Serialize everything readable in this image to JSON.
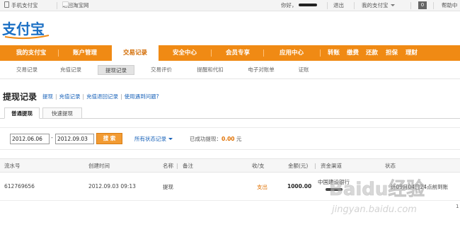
{
  "topbar": {
    "mobile_alipay": "手机支付宝",
    "back_taobao": "返回淘宝网",
    "greeting": "你好，",
    "logout": "退出",
    "my_alipay": "我的支付宝",
    "badge": "0",
    "help": "帮助中"
  },
  "logo": {
    "text": "支付宝"
  },
  "mainnav": {
    "items": [
      "我的支付宝",
      "账户管理",
      "交易记录",
      "安全中心",
      "会员专享",
      "应用中心"
    ],
    "quick_links": [
      "转账",
      "缴费",
      "还款",
      "担保",
      "理财"
    ]
  },
  "subnav": {
    "items": [
      "交易记录",
      "充值记录",
      "提现记录",
      "交易评价",
      "提醒和代扣",
      "电子对账单",
      "证账"
    ]
  },
  "page": {
    "title": "提现记录",
    "links": [
      "提现",
      "充值记录",
      "充值退回记录",
      "使用遇到问题?"
    ]
  },
  "tabs": [
    "普通提现",
    "快速提现"
  ],
  "filter": {
    "start_date": "2012.06.06",
    "end_date": "2012.09.03",
    "search_label": "搜 索",
    "status_filter": "所有状态记录",
    "success_label": "已成功提现：",
    "success_amount": "0.00",
    "success_unit": "元"
  },
  "table": {
    "headers": {
      "serial": "流水号",
      "created": "创建时间",
      "name": "名称",
      "remark": "备注",
      "in_out": "收/支",
      "amount": "金额(元)",
      "channel": "资金渠道",
      "status": "状态"
    },
    "rows": [
      {
        "serial": "612769656",
        "created": "2012.09.03 09:13",
        "name": "提现",
        "in_out": "支出",
        "amount": "1000.00",
        "channel_bank": "中国建设银行",
        "status": "计09月04日24点前到账"
      }
    ]
  },
  "watermark": {
    "brand": "Baidu经验",
    "url": "jingyan.baidu.com"
  },
  "pager": {
    "value": "1"
  },
  "colors": {
    "nav_orange": "#f08a14",
    "link_blue": "#1660b8",
    "amount_orange": "#e07000"
  }
}
